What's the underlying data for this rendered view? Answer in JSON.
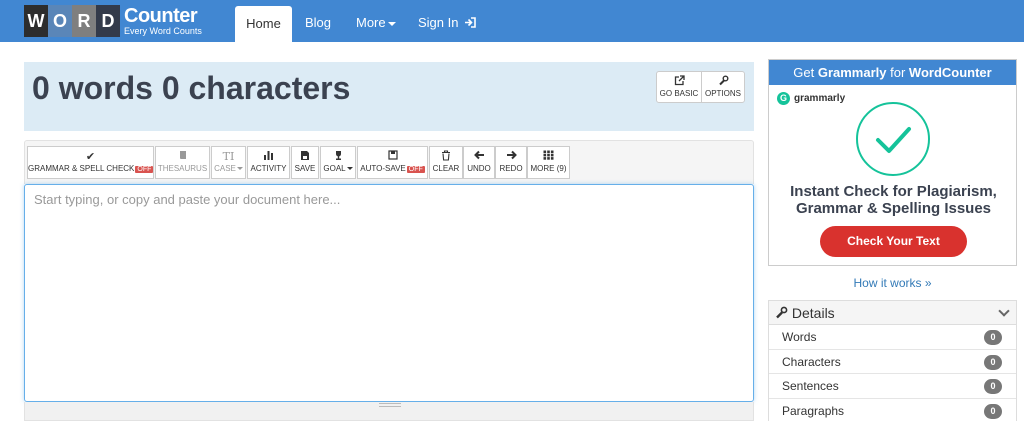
{
  "nav": {
    "logo_letters": [
      "W",
      "O",
      "R",
      "D"
    ],
    "logo_main": "Counter",
    "logo_sub": "Every Word Counts",
    "items": [
      {
        "label": "Home"
      },
      {
        "label": "Blog"
      },
      {
        "label": "More"
      },
      {
        "label": "Sign In"
      }
    ]
  },
  "stats": {
    "title": "0 words 0 characters",
    "go_basic": "GO BASIC",
    "options": "OPTIONS"
  },
  "toolbar": {
    "grammar": "GRAMMAR & SPELL CHECK",
    "grammar_state": "OFF",
    "thesaurus": "THESAURUS",
    "case": "CASE",
    "activity": "ACTIVITY",
    "save": "SAVE",
    "goal": "GOAL",
    "autosave": "AUTO-SAVE",
    "autosave_state": "OFF",
    "clear": "CLEAR",
    "undo": "UNDO",
    "redo": "REDO",
    "more": "MORE (9)"
  },
  "editor": {
    "placeholder": "Start typing, or copy and paste your document here..."
  },
  "ad": {
    "head_prefix": "Get ",
    "head_brand": "Grammarly",
    "head_mid": " for ",
    "head_site": "WordCounter",
    "logo_letter": "G",
    "logo_name": "grammarly",
    "copy_line1": "Instant Check for Plagiarism,",
    "copy_line2": "Grammar & Spelling Issues",
    "cta": "Check Your Text",
    "link": "How it works »"
  },
  "details": {
    "title": "Details",
    "rows": [
      {
        "label": "Words",
        "value": "0"
      },
      {
        "label": "Characters",
        "value": "0"
      },
      {
        "label": "Sentences",
        "value": "0"
      },
      {
        "label": "Paragraphs",
        "value": "0"
      }
    ]
  },
  "colors": {
    "nav_bg": "#4187d2",
    "stats_bg": "#dcebf5",
    "badge_off": "#d9534f",
    "grammarly_green": "#15c39a",
    "cta_red": "#d9322e"
  }
}
